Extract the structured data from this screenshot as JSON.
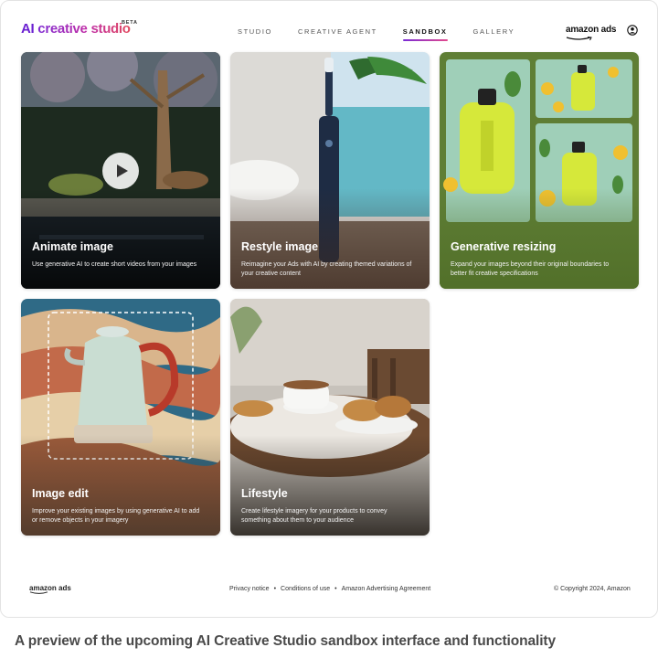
{
  "header": {
    "logo_ai": "AI",
    "logo_rest": " creative studio",
    "logo_badge": "BETA",
    "nav": [
      {
        "label": "STUDIO"
      },
      {
        "label": "CREATIVE AGENT"
      },
      {
        "label": "SANDBOX"
      },
      {
        "label": "GALLERY"
      }
    ],
    "active_nav": "SANDBOX",
    "brand": "amazon ads"
  },
  "cards": [
    {
      "title": "Animate image",
      "description": "Use generative AI to create short videos from your images"
    },
    {
      "title": "Restyle image",
      "description": "Reimagine your Ads with AI by creating themed variations of your creative content"
    },
    {
      "title": "Generative resizing",
      "description": "Expand your images beyond their original boundaries to better fit creative specifications"
    },
    {
      "title": "Image edit",
      "description": "Improve your existing images by using generative AI to add or remove objects in your imagery"
    },
    {
      "title": "Lifestyle",
      "description": "Create lifestyle imagery for your products to convey something about them to your audience"
    }
  ],
  "footer": {
    "brand": "amazon ads",
    "links": [
      "Privacy notice",
      "Conditions of use",
      "Amazon Advertising Agreement"
    ],
    "separator": "•",
    "copyright": "© Copyright 2024, Amazon"
  },
  "caption": "A preview of the upcoming AI Creative Studio sandbox interface and functionality",
  "colors": {
    "accent_start": "#7a2bd6",
    "accent_end": "#e24a5e",
    "resize_card_bg": "#5f7e35"
  }
}
